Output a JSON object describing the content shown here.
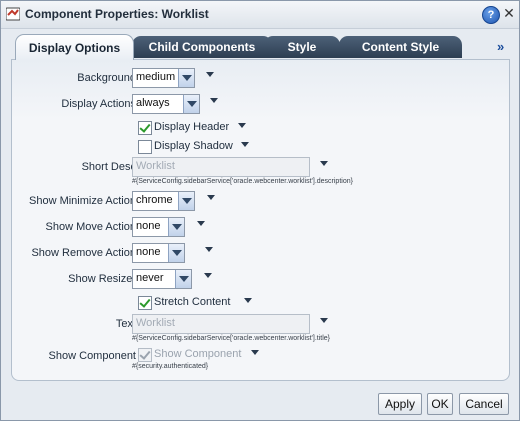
{
  "dialog": {
    "title": "Component Properties: Worklist",
    "help_label": "?",
    "close_label": "✕"
  },
  "tabs": [
    {
      "label": "Display Options",
      "active": true
    },
    {
      "label": "Child Components",
      "active": false
    },
    {
      "label": "Style",
      "active": false
    },
    {
      "label": "Content Style",
      "active": false
    }
  ],
  "tabs_more_label": "»",
  "form": {
    "background": {
      "label": "Background",
      "value": "medium"
    },
    "display_actions": {
      "label": "Display Actions",
      "value": "always"
    },
    "display_header": {
      "label": "Display Header",
      "checked": true
    },
    "display_shadow": {
      "label": "Display Shadow",
      "checked": false
    },
    "short_desc": {
      "label": "Short Desc",
      "value": "Worklist",
      "hint": "#{ServiceConfig.sidebarService['oracle.webcenter.worklist'].description}"
    },
    "show_minimize_action": {
      "label": "Show Minimize Action",
      "value": "chrome"
    },
    "show_move_action": {
      "label": "Show Move Action",
      "value": "none"
    },
    "show_remove_action": {
      "label": "Show Remove Action",
      "value": "none"
    },
    "show_resizer": {
      "label": "Show Resizer",
      "value": "never"
    },
    "stretch_content": {
      "label": "Stretch Content",
      "checked": true
    },
    "text": {
      "label": "Text",
      "value": "Worklist",
      "hint": "#{ServiceConfig.sidebarService['oracle.webcenter.worklist'].title}"
    },
    "show_component": {
      "label": "Show Component",
      "checkbox_label": "Show Component",
      "checked": true,
      "hint": "#{security.authenticated}"
    }
  },
  "buttons": {
    "apply": "Apply",
    "ok": "OK",
    "cancel": "Cancel"
  }
}
